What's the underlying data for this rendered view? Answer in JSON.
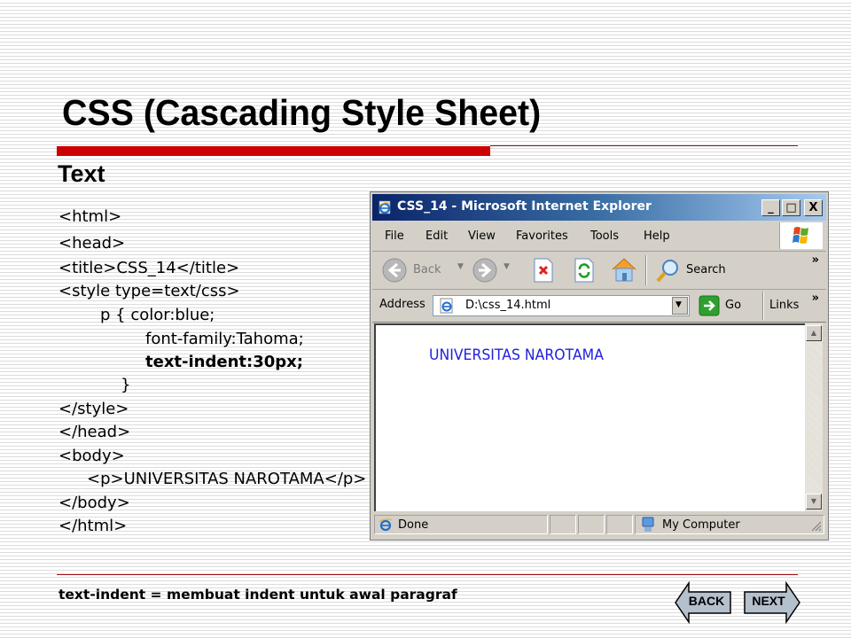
{
  "slide": {
    "title": "CSS (Cascading Style Sheet)",
    "subtitle": "Text",
    "code_lines": [
      {
        "text": "<html>",
        "bold": false
      },
      {
        "text": "<head>",
        "bold": false
      },
      {
        "text": "<title>CSS_14</title>",
        "bold": false
      },
      {
        "text": "<style type=text/css>",
        "bold": false
      },
      {
        "text": "p {  color:blue;",
        "bold": false
      },
      {
        "text": "font-family:Tahoma;",
        "bold": false
      },
      {
        "text": "text-indent:30px;",
        "bold": true
      },
      {
        "text": "}",
        "bold": false
      },
      {
        "text": "</style>",
        "bold": false
      },
      {
        "text": "</head>",
        "bold": false
      },
      {
        "text": "<body>",
        "bold": false
      },
      {
        "text": "<p>UNIVERSITAS  NAROTAMA</p>",
        "bold": false
      },
      {
        "text": "</body>",
        "bold": false
      },
      {
        "text": "</html>",
        "bold": false
      }
    ],
    "footnote": "text-indent = membuat indent untuk awal paragraf",
    "nav": {
      "back_label": "BACK",
      "next_label": "NEXT"
    },
    "colors": {
      "accent_red": "#cc0000",
      "arrow_fill": "#b4c0cc"
    }
  },
  "browser": {
    "window_title": "CSS_14 - Microsoft Internet Explorer",
    "window_buttons": {
      "minimize": "_",
      "maximize": "□",
      "close": "X"
    },
    "menu": [
      "File",
      "Edit",
      "View",
      "Favorites",
      "Tools",
      "Help"
    ],
    "toolbar": {
      "back": "Back",
      "search": "Search",
      "overflow": "»"
    },
    "address": {
      "label": "Address",
      "value": "D:\\css_14.html",
      "go": "Go",
      "links": "Links",
      "overflow": "»"
    },
    "content": {
      "paragraph": "UNIVERSITAS NAROTAMA",
      "text_color": "#2020e0"
    },
    "status": {
      "left": "Done",
      "zone": "My Computer"
    }
  }
}
